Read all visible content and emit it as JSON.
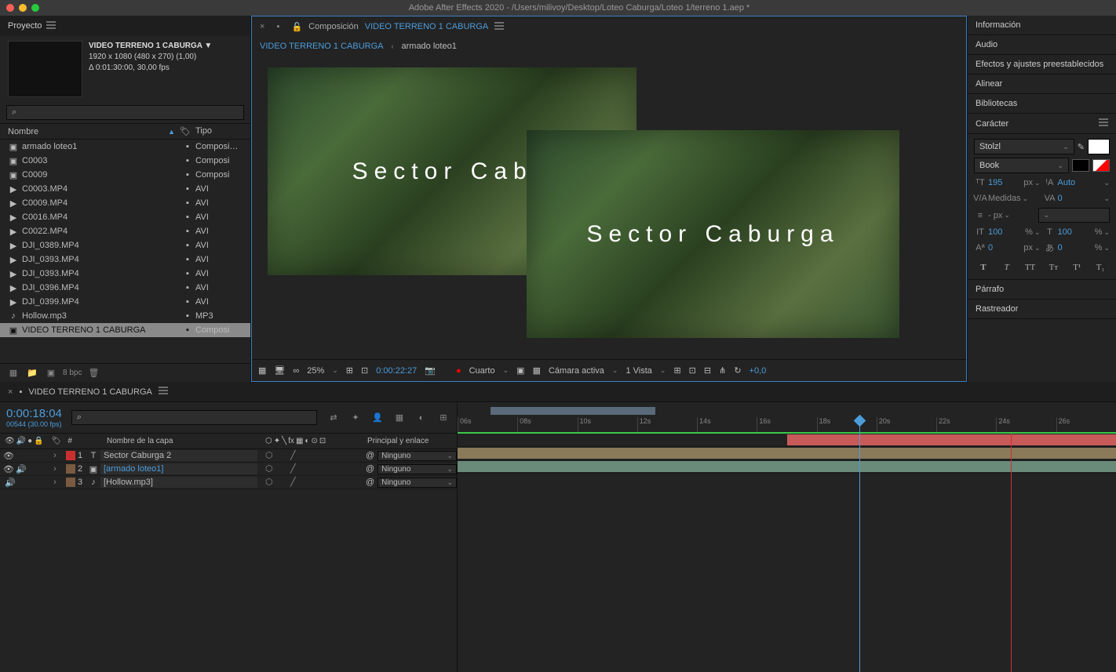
{
  "app": {
    "title": "Adobe After Effects 2020 - /Users/milivoy/Desktop/Loteo Caburga/Loteo 1/terreno 1.aep *"
  },
  "project": {
    "panel_title": "Proyecto",
    "comp_name": "VIDEO TERRENO 1 CABURGA",
    "dimensions": "1920 x 1080  (480 x 270) (1,00)",
    "duration": "Δ 0:01:30:00, 30,00 fps",
    "search_placeholder": "",
    "col_nombre": "Nombre",
    "col_tipo": "Tipo",
    "bpc_label": "8 bpc",
    "items": [
      {
        "name": "armado loteo1",
        "tipo": "Composi…",
        "icon": "comp"
      },
      {
        "name": "C0003",
        "tipo": "Composi",
        "icon": "comp"
      },
      {
        "name": "C0009",
        "tipo": "Composi",
        "icon": "comp"
      },
      {
        "name": "C0003.MP4",
        "tipo": "AVI",
        "icon": "av"
      },
      {
        "name": "C0009.MP4",
        "tipo": "AVI",
        "icon": "av"
      },
      {
        "name": "C0016.MP4",
        "tipo": "AVI",
        "icon": "av"
      },
      {
        "name": "C0022.MP4",
        "tipo": "AVI",
        "icon": "av"
      },
      {
        "name": "DJI_0389.MP4",
        "tipo": "AVI",
        "icon": "av"
      },
      {
        "name": "DJI_0393.MP4",
        "tipo": "AVI",
        "icon": "av"
      },
      {
        "name": "DJI_0393.MP4",
        "tipo": "AVI",
        "icon": "av"
      },
      {
        "name": "DJI_0396.MP4",
        "tipo": "AVI",
        "icon": "av"
      },
      {
        "name": "DJI_0399.MP4",
        "tipo": "AVI",
        "icon": "av"
      },
      {
        "name": "Hollow.mp3",
        "tipo": "MP3",
        "icon": "audio"
      },
      {
        "name": "VIDEO TERRENO 1 CABURGA",
        "tipo": "Composi",
        "icon": "comp",
        "selected": true
      }
    ]
  },
  "composition": {
    "label": "Composición",
    "name": "VIDEO TERRENO 1 CABURGA",
    "breadcrumb_active": "VIDEO TERRENO 1 CABURGA",
    "breadcrumb_next": "armado loteo1",
    "text_overlay": "Sector Caburga",
    "text_overlay_partial": "Sector Cabu"
  },
  "viewer": {
    "zoom": "25%",
    "timecode": "0:00:22:27",
    "resolution": "Cuarto",
    "camera": "Cámara activa",
    "views": "1 Vista",
    "exposure": "+0,0"
  },
  "right_panels": {
    "info": "Información",
    "audio": "Audio",
    "effects": "Efectos y ajustes preestablecidos",
    "align": "Alinear",
    "libraries": "Bibliotecas",
    "character": "Carácter",
    "paragraph": "Párrafo",
    "tracker": "Rastreador"
  },
  "character": {
    "font": "Stolzl",
    "weight": "Book",
    "size_value": "195",
    "size_unit": "px",
    "leading": "Auto",
    "kerning_label": "Medidas",
    "tracking": "0",
    "line_height": "- px",
    "scale_v": "100",
    "scale_h": "100",
    "baseline": "0",
    "tsume": "0",
    "percent": "%",
    "px": "px"
  },
  "timeline": {
    "tab_name": "VIDEO TERRENO 1 CABURGA",
    "timecode": "0:00:18:04",
    "fps": "00544 (30.00 fps)",
    "col_num": "#",
    "col_name": "Nombre de la capa",
    "col_parent": "Principal y enlace",
    "parent_none": "Ninguno",
    "ticks": [
      "06s",
      "08s",
      "10s",
      "12s",
      "14s",
      "16s",
      "18s",
      "20s",
      "22s",
      "24s",
      "26s"
    ],
    "layers": [
      {
        "num": "1",
        "name": "Sector Caburga 2",
        "kind": "T",
        "parent": "Ninguno"
      },
      {
        "num": "2",
        "name": "[armado loteo1]",
        "kind": "comp",
        "parent": "Ninguno",
        "linked": true
      },
      {
        "num": "3",
        "name": "[Hollow.mp3]",
        "kind": "audio",
        "parent": "Ninguno"
      }
    ]
  }
}
